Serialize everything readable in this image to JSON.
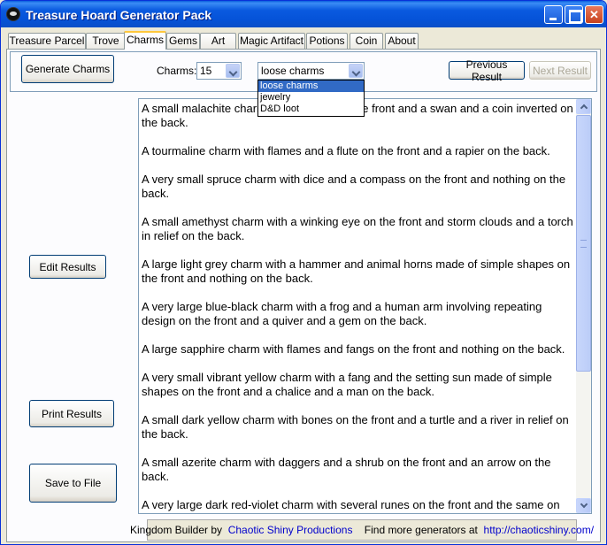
{
  "window": {
    "title": "Treasure Hoard Generator Pack"
  },
  "tabs": [
    {
      "label": "Treasure Parcel"
    },
    {
      "label": "Trove"
    },
    {
      "label": "Charms"
    },
    {
      "label": "Gems"
    },
    {
      "label": "Art"
    },
    {
      "label": "Magic Artifact"
    },
    {
      "label": "Potions"
    },
    {
      "label": "Coin"
    },
    {
      "label": "About"
    }
  ],
  "active_tab": "Charms",
  "controls": {
    "generate_label": "Generate Charms",
    "charms_label": "Charms:",
    "count_value": "15",
    "type_value": "loose charms",
    "type_options": [
      "loose charms",
      "jewelry",
      "D&D loot"
    ],
    "previous_label": "Previous Result",
    "next_label": "Next Result"
  },
  "side_buttons": {
    "edit_label": "Edit Results",
    "print_label": "Print Results",
    "save_label": "Save to File"
  },
  "results": [
    "A small malachite charm with a sword on the front and a swan and a coin inverted on the back.",
    "A tourmaline charm with flames and a flute on the front and a rapier on the back.",
    "A very small spruce charm with dice and a compass on the front and nothing on the back.",
    "A small amethyst charm with a winking eye on the front and storm clouds and a torch in relief on the back.",
    "A large light grey charm with a hammer and animal horns made of simple shapes on the front and nothing on the back.",
    "A very large blue-black charm with a frog and a human arm involving repeating design on the front and a quiver and a gem on the back.",
    "A large sapphire charm with flames and fangs on the front and nothing on the back.",
    "A very small vibrant yellow charm with a fang and the setting sun made of simple shapes on the front and a chalice and a man on the back.",
    "A small dark yellow charm with bones on the front and a turtle and a river in relief on the back.",
    "A small azerite charm with daggers and a shrub on the front and an arrow on the back.",
    "A very large dark red-violet charm with several runes on the front and the same on"
  ],
  "footer": {
    "prefix": "Kingdom Builder by",
    "company": "Chaotic Shiny Productions",
    "middle": "Find more generators at",
    "url": "http://chaoticshiny.com/"
  },
  "colors": {
    "title_bar": "#0a5ae0",
    "link": "#0000cc",
    "selection": "#316ac5",
    "active_tab_accent": "#ffc83c"
  }
}
